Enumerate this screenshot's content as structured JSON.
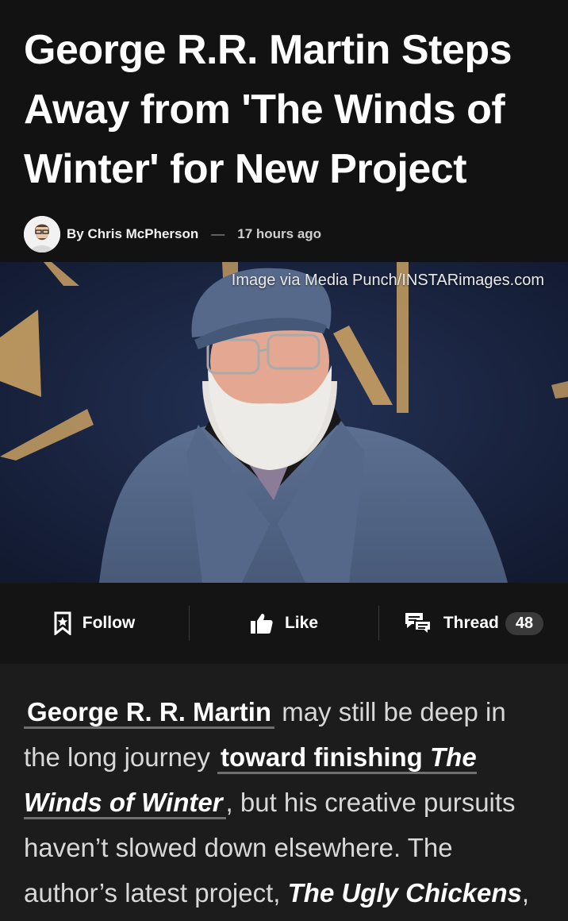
{
  "article": {
    "headline": "George R.R. Martin Steps Away from 'The Winds of Winter' for New Project",
    "author": "By Chris McPherson",
    "separator": "—",
    "time_ago": "17 hours ago",
    "image_credit": "Image via Media Punch/INSTARimages.com"
  },
  "actions": {
    "follow_label": "Follow",
    "like_label": "Like",
    "thread_label": "Thread",
    "thread_count": "48"
  },
  "body": {
    "link_name": "George R. R. Martin",
    "text_1": " may still be deep in the long journey ",
    "link_toward": "toward finishing ",
    "link_title": "The Winds of Winter",
    "text_2": ", but his creative pursuits haven’t slowed down elsewhere. The author’s latest project, ",
    "project_title": "The Ugly Chickens",
    "text_3": ","
  },
  "colors": {
    "background": "#121212",
    "body_background": "#1c1c1c",
    "hero_background": "#1e2a48",
    "accent_gold": "#c9a063"
  }
}
